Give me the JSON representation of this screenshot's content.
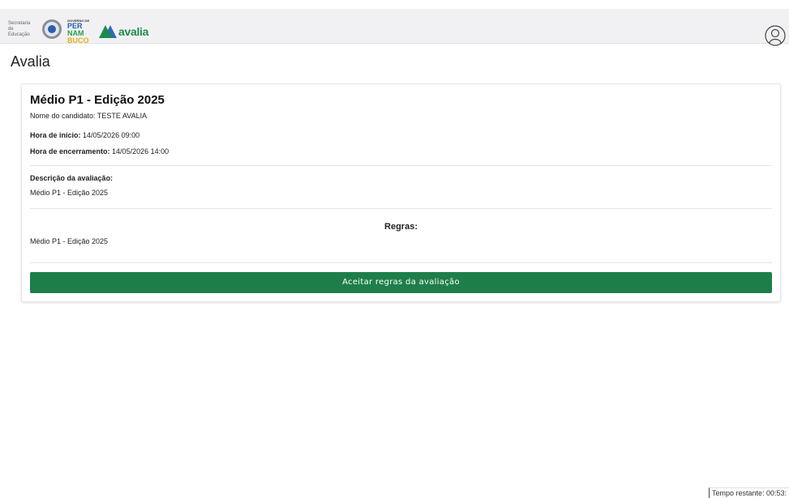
{
  "header": {
    "secretaria_text": "Secretaria de Educação",
    "governo_text": "GOVERNO DE",
    "pe_lines": [
      "PER",
      "NAM",
      "BUCO"
    ],
    "avalia_logo_text": "avalia"
  },
  "page": {
    "title": "Avalia"
  },
  "exam": {
    "title": "Médio P1 - Edição 2025",
    "candidate_label": "Nome do candidato:",
    "candidate_value": "TESTE AVALIA",
    "start_label": "Hora de início:",
    "start_value": "14/05/2026 09:00",
    "end_label": "Hora de encerramento:",
    "end_value": "14/05/2026 14:00",
    "description_label": "Descrição da avaliação:",
    "description_value": "Médio P1 - Edição 2025",
    "rules_label": "Regras:",
    "rules_value": "Médio P1 - Edição 2025",
    "accept_button": "Aceitar regras da avaliação"
  },
  "timer": {
    "text": "Tempo restante: 00:53:"
  },
  "colors": {
    "accent_green": "#1e7e4a",
    "header_bg": "#f1f1f3"
  }
}
